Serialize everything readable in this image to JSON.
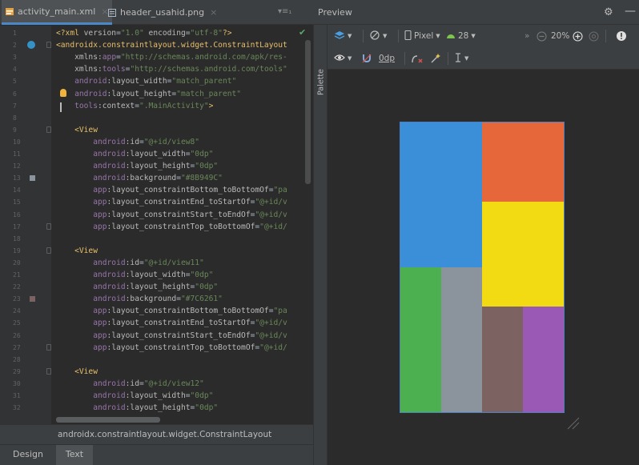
{
  "editor": {
    "tabs": [
      {
        "label": "activity_main.xml",
        "active": true
      },
      {
        "label": "header_usahid.png",
        "active": false
      }
    ],
    "tab_menu": "▾≡₁",
    "lines": [
      {
        "n": "1",
        "parts": [
          [
            "t-tag",
            "<?xml "
          ],
          [
            "t-attr",
            "version"
          ],
          [
            "t-plain",
            "="
          ],
          [
            "t-str",
            "\"1.0\""
          ],
          [
            "t-attr",
            " encoding"
          ],
          [
            "t-plain",
            "="
          ],
          [
            "t-str",
            "\"utf-8\""
          ],
          [
            "t-tag",
            "?>"
          ]
        ]
      },
      {
        "n": "2",
        "parts": [
          [
            "t-tag",
            "<androidx.constraintlayout.widget.ConstraintLayout"
          ]
        ]
      },
      {
        "n": "3",
        "parts": [
          [
            "t-attr",
            "    xmlns:"
          ],
          [
            "t-ns",
            "app"
          ],
          [
            "t-plain",
            "="
          ],
          [
            "t-str",
            "\"http://schemas.android.com/apk/res-"
          ]
        ]
      },
      {
        "n": "4",
        "parts": [
          [
            "t-attr",
            "    xmlns:"
          ],
          [
            "t-ns",
            "tools"
          ],
          [
            "t-plain",
            "="
          ],
          [
            "t-str",
            "\"http://schemas.android.com/tools\""
          ]
        ]
      },
      {
        "n": "5",
        "parts": [
          [
            "t-ns",
            "    android"
          ],
          [
            "t-attr",
            ":layout_width"
          ],
          [
            "t-plain",
            "="
          ],
          [
            "t-str",
            "\"match_parent\""
          ]
        ]
      },
      {
        "n": "6",
        "parts": [
          [
            "t-ns",
            "    android"
          ],
          [
            "t-attr",
            ":layout_height"
          ],
          [
            "t-plain",
            "="
          ],
          [
            "t-str",
            "\"match_parent\""
          ]
        ]
      },
      {
        "n": "7",
        "parts": [
          [
            "t-ns",
            "    tools"
          ],
          [
            "t-attr",
            ":context"
          ],
          [
            "t-plain",
            "="
          ],
          [
            "t-str",
            "\".MainActivity\""
          ],
          [
            "t-tag",
            ">"
          ]
        ]
      },
      {
        "n": "8",
        "parts": []
      },
      {
        "n": "9",
        "parts": [
          [
            "t-tag",
            "    <View"
          ]
        ]
      },
      {
        "n": "10",
        "parts": [
          [
            "t-ns",
            "        android"
          ],
          [
            "t-attr",
            ":id"
          ],
          [
            "t-plain",
            "="
          ],
          [
            "t-str",
            "\"@+id/view8\""
          ]
        ]
      },
      {
        "n": "11",
        "parts": [
          [
            "t-ns",
            "        android"
          ],
          [
            "t-attr",
            ":layout_width"
          ],
          [
            "t-plain",
            "="
          ],
          [
            "t-str",
            "\"0dp\""
          ]
        ]
      },
      {
        "n": "12",
        "parts": [
          [
            "t-ns",
            "        android"
          ],
          [
            "t-attr",
            ":layout_height"
          ],
          [
            "t-plain",
            "="
          ],
          [
            "t-str",
            "\"0dp\""
          ]
        ]
      },
      {
        "n": "13",
        "parts": [
          [
            "t-ns",
            "        android"
          ],
          [
            "t-attr",
            ":background"
          ],
          [
            "t-plain",
            "="
          ],
          [
            "t-str",
            "\"#8B949C\""
          ]
        ]
      },
      {
        "n": "14",
        "parts": [
          [
            "t-ns",
            "        app"
          ],
          [
            "t-attr",
            ":layout_constraintBottom_toBottomOf"
          ],
          [
            "t-plain",
            "="
          ],
          [
            "t-str",
            "\"pa"
          ]
        ]
      },
      {
        "n": "15",
        "parts": [
          [
            "t-ns",
            "        app"
          ],
          [
            "t-attr",
            ":layout_constraintEnd_toStartOf"
          ],
          [
            "t-plain",
            "="
          ],
          [
            "t-str",
            "\"@+id/v"
          ]
        ]
      },
      {
        "n": "16",
        "parts": [
          [
            "t-ns",
            "        app"
          ],
          [
            "t-attr",
            ":layout_constraintStart_toEndOf"
          ],
          [
            "t-plain",
            "="
          ],
          [
            "t-str",
            "\"@+id/v"
          ]
        ]
      },
      {
        "n": "17",
        "parts": [
          [
            "t-ns",
            "        app"
          ],
          [
            "t-attr",
            ":layout_constraintTop_toBottomOf"
          ],
          [
            "t-plain",
            "="
          ],
          [
            "t-str",
            "\"@+id/"
          ]
        ]
      },
      {
        "n": "18",
        "parts": []
      },
      {
        "n": "19",
        "parts": [
          [
            "t-tag",
            "    <View"
          ]
        ]
      },
      {
        "n": "20",
        "parts": [
          [
            "t-ns",
            "        android"
          ],
          [
            "t-attr",
            ":id"
          ],
          [
            "t-plain",
            "="
          ],
          [
            "t-str",
            "\"@+id/view11\""
          ]
        ]
      },
      {
        "n": "21",
        "parts": [
          [
            "t-ns",
            "        android"
          ],
          [
            "t-attr",
            ":layout_width"
          ],
          [
            "t-plain",
            "="
          ],
          [
            "t-str",
            "\"0dp\""
          ]
        ]
      },
      {
        "n": "22",
        "parts": [
          [
            "t-ns",
            "        android"
          ],
          [
            "t-attr",
            ":layout_height"
          ],
          [
            "t-plain",
            "="
          ],
          [
            "t-str",
            "\"0dp\""
          ]
        ]
      },
      {
        "n": "23",
        "parts": [
          [
            "t-ns",
            "        android"
          ],
          [
            "t-attr",
            ":background"
          ],
          [
            "t-plain",
            "="
          ],
          [
            "t-str",
            "\"#7C6261\""
          ]
        ]
      },
      {
        "n": "24",
        "parts": [
          [
            "t-ns",
            "        app"
          ],
          [
            "t-attr",
            ":layout_constraintBottom_toBottomOf"
          ],
          [
            "t-plain",
            "="
          ],
          [
            "t-str",
            "\"pa"
          ]
        ]
      },
      {
        "n": "25",
        "parts": [
          [
            "t-ns",
            "        app"
          ],
          [
            "t-attr",
            ":layout_constraintEnd_toStartOf"
          ],
          [
            "t-plain",
            "="
          ],
          [
            "t-str",
            "\"@+id/v"
          ]
        ]
      },
      {
        "n": "26",
        "parts": [
          [
            "t-ns",
            "        app"
          ],
          [
            "t-attr",
            ":layout_constraintStart_toEndOf"
          ],
          [
            "t-plain",
            "="
          ],
          [
            "t-str",
            "\"@+id/v"
          ]
        ]
      },
      {
        "n": "27",
        "parts": [
          [
            "t-ns",
            "        app"
          ],
          [
            "t-attr",
            ":layout_constraintTop_toBottomOf"
          ],
          [
            "t-plain",
            "="
          ],
          [
            "t-str",
            "\"@+id/"
          ]
        ]
      },
      {
        "n": "28",
        "parts": []
      },
      {
        "n": "29",
        "parts": [
          [
            "t-tag",
            "    <View"
          ]
        ]
      },
      {
        "n": "30",
        "parts": [
          [
            "t-ns",
            "        android"
          ],
          [
            "t-attr",
            ":id"
          ],
          [
            "t-plain",
            "="
          ],
          [
            "t-str",
            "\"@+id/view12\""
          ]
        ]
      },
      {
        "n": "31",
        "parts": [
          [
            "t-ns",
            "        android"
          ],
          [
            "t-attr",
            ":layout_width"
          ],
          [
            "t-plain",
            "="
          ],
          [
            "t-str",
            "\"0dp\""
          ]
        ]
      },
      {
        "n": "32",
        "parts": [
          [
            "t-ns",
            "        android"
          ],
          [
            "t-attr",
            ":layout_height"
          ],
          [
            "t-plain",
            "="
          ],
          [
            "t-str",
            "\"0dp\""
          ]
        ]
      }
    ],
    "color_swatches": {
      "13": "#8B949C",
      "23": "#7C6261"
    },
    "breadcrumb": "androidx.constraintlayout.widget.ConstraintLayout",
    "bottom_tabs": [
      {
        "label": "Design",
        "active": false
      },
      {
        "label": "Text",
        "active": true
      }
    ]
  },
  "palette": {
    "label": "Palette"
  },
  "preview": {
    "title": "Preview",
    "toolbar1": {
      "device": "Pixel",
      "api": "28",
      "zoom": "20%"
    },
    "toolbar2": {
      "margin": "0dp"
    },
    "layout_colors": {
      "blue": "#3b8fd9",
      "orange": "#e5673a",
      "yellow": "#f2db12",
      "green": "#4caf50",
      "gray": "#8b949c",
      "brown": "#7c6261",
      "purple": "#9b59b6"
    }
  }
}
